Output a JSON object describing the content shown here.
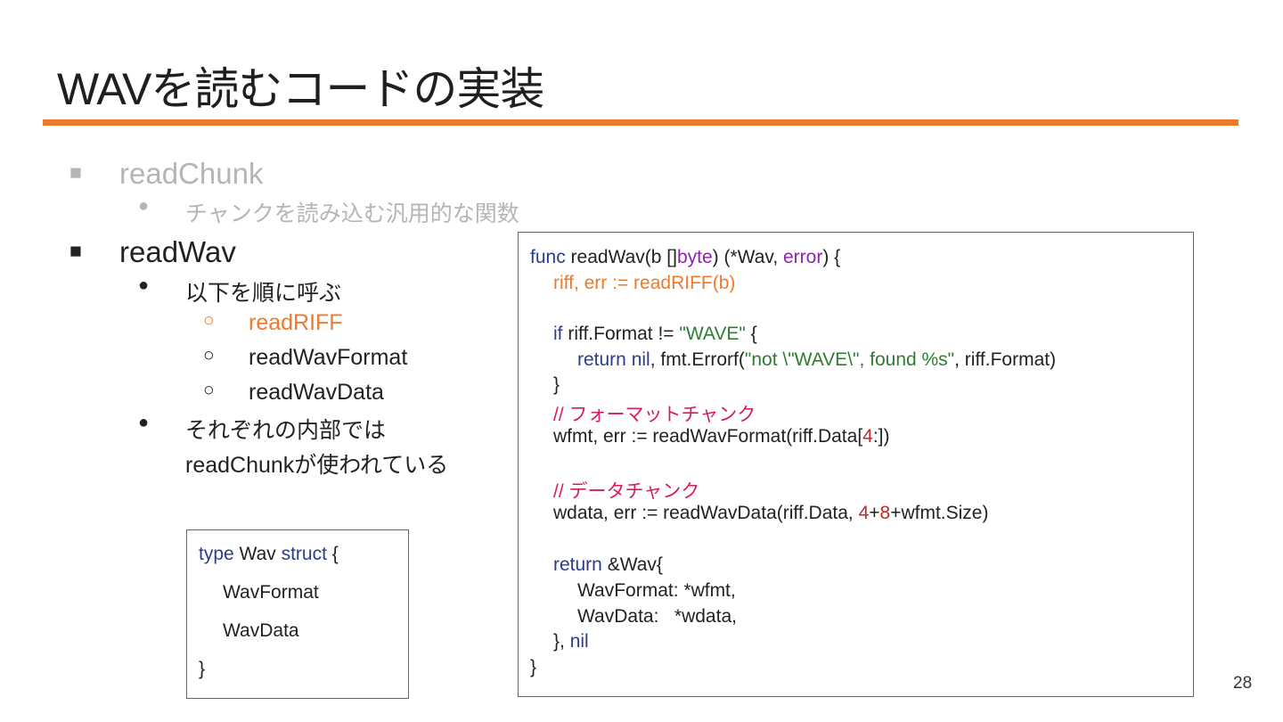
{
  "slide": {
    "title": "WAVを読むコードの実装",
    "page_number": "28",
    "accent_color": "#F07A2B"
  },
  "bullets": {
    "item1": {
      "marker": "■",
      "label": "readChunk",
      "sub1": {
        "marker": "●",
        "label": "チャンクを読み込む汎用的な関数"
      }
    },
    "item2": {
      "marker": "■",
      "label": "readWav",
      "sub1": {
        "marker": "●",
        "label": "以下を順に呼ぶ",
        "children": [
          {
            "marker": "○",
            "label": "readRIFF"
          },
          {
            "marker": "○",
            "label": "readWavFormat"
          },
          {
            "marker": "○",
            "label": "readWavData"
          }
        ]
      },
      "sub2": {
        "marker": "●",
        "line1": "それぞれの内部では",
        "line2": "readChunkが使われている"
      }
    }
  },
  "code_main": {
    "l1": {
      "a": "func",
      "b": " readWav(b []",
      "c": "byte",
      "d": ") (*Wav, ",
      "e": "error",
      "f": ") {"
    },
    "l2": {
      "a": "riff, err := readRIFF(b)"
    },
    "l3": {
      "a": "if",
      "b": " riff.Format != ",
      "c": "\"WAVE\"",
      "d": " {"
    },
    "l4": {
      "a": "return",
      "b": " ",
      "c": "nil",
      "d": ", fmt.Errorf(",
      "e": "\"not \\\"WAVE\\\", found %s\"",
      "f": ", riff.Format)"
    },
    "l5": {
      "a": "}"
    },
    "l6": {
      "a": "// フォーマットチャンク"
    },
    "l7": {
      "a": "wfmt, err := readWavFormat(riff.Data[",
      "b": "4",
      "c": ":])"
    },
    "l8": {
      "a": "// データチャンク"
    },
    "l9": {
      "a": "wdata, err := readWavData(riff.Data, ",
      "b": "4",
      "c": "+",
      "d": "8",
      "e": "+wfmt.Size)"
    },
    "l10": {
      "a": "return",
      "b": " &Wav{"
    },
    "l11": {
      "a": "WavFormat: *wfmt,"
    },
    "l12": {
      "a": "WavData:   *wdata,"
    },
    "l13": {
      "a": "}, ",
      "b": "nil"
    },
    "l14": {
      "a": "}"
    }
  },
  "code_struct": {
    "l1": {
      "a": "type",
      "b": " Wav ",
      "c": "struct",
      "d": " {"
    },
    "l2": {
      "a": "WavFormat"
    },
    "l3": {
      "a": "WavData"
    },
    "l4": {
      "a": "}"
    }
  }
}
